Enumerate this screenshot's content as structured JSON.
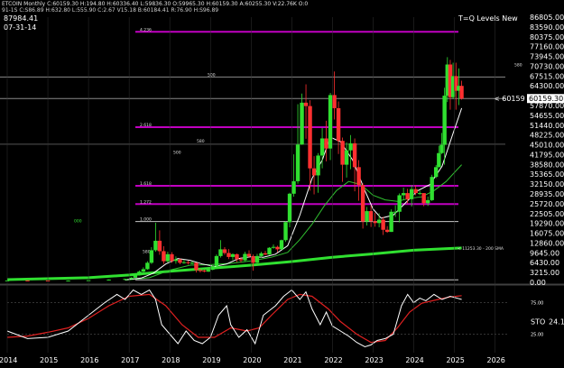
{
  "header": {
    "line1": "ETCOIN Monthly  C:60159.30  H:194.80  H:60336.40  L:59836.30  O:59965.30  H:60159.30  A:60255.30  V:22.76K  O:0",
    "line2": "91-1S  C:S86.89  H:632.80  L:555.90  C:2.67  V15.18  B:60184.41  R:76.90  H:S96.89",
    "price_box": "87984.41",
    "date_box": "07-31-14",
    "study_title": "T=Q Levels New"
  },
  "price_axis": [
    "86805.00",
    "83590.00",
    "80375.00",
    "77160.00",
    "73945.00",
    "70730.00",
    "67515.00",
    "64300.00",
    "60159.30",
    "57870.00",
    "54655.00",
    "51440.00",
    "48225.00",
    "45010.00",
    "41795.00",
    "38580.00",
    "35365.00",
    "32150.00",
    "28935.00",
    "25720.00",
    "22505.00",
    "19290.00",
    "16075.00",
    "12860.00",
    "9645.00",
    "6430.00",
    "3215.00",
    "0.00"
  ],
  "current_price_label": "< 60159",
  "level_labels": {
    "l4236": "4.236",
    "l500a": "500",
    "l2618": "2.618",
    "l580": "580",
    "l500b": "500",
    "l1618": "1.618",
    "l1272": "1.272",
    "l1000": "1.000",
    "l000": "000",
    "l580b": "580",
    "l580c": "580"
  },
  "sma_label": "< 11253.30 - 200 SMA",
  "stoch_axis": {
    "upper": "75.00",
    "lower": "25.00"
  },
  "stoch_label": "STO",
  "stoch_value": "24.1",
  "x_years": [
    "2014",
    "2015",
    "2016",
    "2017",
    "2018",
    "2019",
    "2020",
    "2021",
    "2022",
    "2023",
    "2024",
    "2025",
    "2026"
  ],
  "chart_data": {
    "type": "candlestick",
    "title": "T=Q Levels New",
    "ylim": [
      0,
      86805
    ],
    "x_range": [
      2014.0,
      2026.3
    ],
    "candles": [
      [
        2014.0,
        600,
        620,
        640,
        580
      ],
      [
        2014.5,
        620,
        600,
        650,
        580
      ],
      [
        2015.0,
        600,
        560,
        640,
        540
      ],
      [
        2015.5,
        560,
        600,
        620,
        540
      ],
      [
        2016.0,
        600,
        700,
        720,
        590
      ],
      [
        2016.5,
        700,
        900,
        950,
        680
      ],
      [
        2016.9,
        900,
        1100,
        1200,
        880
      ],
      [
        2017.05,
        1100,
        1500,
        1700,
        1050
      ],
      [
        2017.15,
        1500,
        2300,
        2600,
        1450
      ],
      [
        2017.25,
        2300,
        3500,
        3900,
        2200
      ],
      [
        2017.35,
        3500,
        4300,
        4900,
        3200
      ],
      [
        2017.45,
        4300,
        6400,
        6900,
        4100
      ],
      [
        2017.55,
        6400,
        10500,
        11500,
        6000
      ],
      [
        2017.65,
        10500,
        13600,
        19500,
        10000
      ],
      [
        2017.75,
        13600,
        10200,
        17000,
        9000
      ],
      [
        2017.85,
        10200,
        6900,
        11800,
        6000
      ],
      [
        2017.95,
        6900,
        9200,
        10000,
        6500
      ],
      [
        2018.05,
        9200,
        7000,
        9900,
        6400
      ],
      [
        2018.15,
        7000,
        7500,
        8500,
        6100
      ],
      [
        2018.25,
        7500,
        6400,
        7800,
        5900
      ],
      [
        2018.35,
        6400,
        6600,
        7400,
        6100
      ],
      [
        2018.45,
        6600,
        6300,
        7100,
        5800
      ],
      [
        2018.55,
        6300,
        6400,
        6900,
        5900
      ],
      [
        2018.65,
        6400,
        4000,
        6500,
        3200
      ],
      [
        2018.75,
        4000,
        3800,
        4400,
        3200
      ],
      [
        2018.85,
        3800,
        3500,
        4200,
        3300
      ],
      [
        2018.95,
        3500,
        4100,
        4200,
        3400
      ],
      [
        2019.05,
        4100,
        5300,
        5500,
        4000
      ],
      [
        2019.15,
        5300,
        8600,
        9100,
        5200
      ],
      [
        2019.25,
        8600,
        10800,
        13800,
        8100
      ],
      [
        2019.35,
        10800,
        9600,
        11500,
        9000
      ],
      [
        2019.45,
        9600,
        8300,
        10900,
        7600
      ],
      [
        2019.55,
        8300,
        9200,
        9500,
        7300
      ],
      [
        2019.65,
        9200,
        7600,
        9400,
        6600
      ],
      [
        2019.75,
        7600,
        7200,
        8300,
        6500
      ],
      [
        2019.85,
        7200,
        9300,
        10000,
        6900
      ],
      [
        2019.95,
        9300,
        8500,
        10500,
        8000
      ],
      [
        2020.05,
        8500,
        6400,
        9100,
        3800
      ],
      [
        2020.15,
        6400,
        8600,
        9300,
        6200
      ],
      [
        2020.25,
        8600,
        9500,
        10000,
        8100
      ],
      [
        2020.35,
        9500,
        9100,
        10300,
        8900
      ],
      [
        2020.45,
        9100,
        11300,
        11500,
        9000
      ],
      [
        2020.55,
        11300,
        11600,
        12400,
        11000
      ],
      [
        2020.65,
        11600,
        10800,
        12000,
        9900
      ],
      [
        2020.75,
        10800,
        13800,
        14000,
        10600
      ],
      [
        2020.85,
        13800,
        19700,
        19900,
        13200
      ],
      [
        2020.95,
        19700,
        29000,
        29300,
        18000
      ],
      [
        2021.05,
        29000,
        33100,
        41900,
        28000
      ],
      [
        2021.15,
        33100,
        45100,
        58300,
        32300
      ],
      [
        2021.25,
        45100,
        58800,
        61800,
        45000
      ],
      [
        2021.35,
        58800,
        57700,
        64800,
        47000
      ],
      [
        2021.45,
        57700,
        37300,
        59600,
        30000
      ],
      [
        2021.55,
        37300,
        35000,
        41300,
        28800
      ],
      [
        2021.65,
        35000,
        41500,
        42300,
        29300
      ],
      [
        2021.75,
        41500,
        47100,
        50500,
        37300
      ],
      [
        2021.85,
        47100,
        43800,
        52900,
        39600
      ],
      [
        2021.95,
        43800,
        61300,
        62000,
        40000
      ],
      [
        2022.05,
        61300,
        57000,
        69000,
        53300
      ],
      [
        2022.15,
        57000,
        46300,
        59200,
        42000
      ],
      [
        2022.25,
        46300,
        38500,
        47400,
        32900
      ],
      [
        2022.35,
        38500,
        43200,
        45800,
        34300
      ],
      [
        2022.45,
        43200,
        45500,
        48200,
        37000
      ],
      [
        2022.55,
        45500,
        37700,
        47100,
        29800
      ],
      [
        2022.65,
        37700,
        31800,
        40000,
        26700
      ],
      [
        2022.75,
        31800,
        19900,
        32400,
        17600
      ],
      [
        2022.85,
        19900,
        23300,
        24700,
        18600
      ],
      [
        2022.95,
        23300,
        20000,
        25200,
        18100
      ],
      [
        2023.05,
        20000,
        19400,
        22800,
        18200
      ],
      [
        2023.15,
        19400,
        20500,
        22600,
        18000
      ],
      [
        2023.25,
        20500,
        17200,
        21400,
        15500
      ],
      [
        2023.35,
        17200,
        16500,
        18400,
        16200
      ],
      [
        2023.45,
        16500,
        23100,
        23900,
        16500
      ],
      [
        2023.55,
        23100,
        23100,
        25200,
        21400
      ],
      [
        2023.65,
        23100,
        28500,
        29100,
        19600
      ],
      [
        2023.75,
        28500,
        29200,
        31000,
        26900
      ],
      [
        2023.85,
        29200,
        27200,
        30600,
        25800
      ],
      [
        2023.95,
        27200,
        30500,
        31800,
        24800
      ],
      [
        2024.05,
        30500,
        29200,
        31800,
        28500
      ],
      [
        2024.15,
        29200,
        29200,
        30000,
        28500
      ],
      [
        2024.25,
        29200,
        25900,
        29200,
        24900
      ],
      [
        2024.35,
        25900,
        26900,
        28100,
        25000
      ],
      [
        2024.45,
        26900,
        34500,
        35200,
        26600
      ],
      [
        2024.55,
        34500,
        37700,
        38400,
        34100
      ],
      [
        2024.62,
        37700,
        42300,
        44700,
        37600
      ],
      [
        2024.69,
        42300,
        45000,
        48900,
        42000
      ],
      [
        2024.76,
        45000,
        61100,
        63700,
        38500
      ],
      [
        2024.83,
        61100,
        71300,
        73700,
        59000
      ],
      [
        2024.9,
        71300,
        60600,
        72800,
        56500
      ],
      [
        2024.97,
        60600,
        67500,
        71900,
        60000
      ],
      [
        2025.04,
        67500,
        62700,
        71900,
        56500
      ],
      [
        2025.11,
        62700,
        64300,
        70000,
        58000
      ],
      [
        2025.18,
        64300,
        60159,
        66000,
        59800
      ]
    ],
    "sma_fast": [
      [
        2016.9,
        800
      ],
      [
        2017.3,
        1400
      ],
      [
        2017.6,
        3000
      ],
      [
        2017.9,
        6000
      ],
      [
        2018.2,
        7800
      ],
      [
        2018.5,
        7200
      ],
      [
        2018.8,
        6000
      ],
      [
        2019.1,
        5200
      ],
      [
        2019.4,
        6000
      ],
      [
        2019.7,
        7800
      ],
      [
        2020.0,
        8400
      ],
      [
        2020.3,
        8200
      ],
      [
        2020.6,
        9200
      ],
      [
        2020.9,
        12000
      ],
      [
        2021.2,
        22000
      ],
      [
        2021.5,
        34000
      ],
      [
        2021.75,
        40000
      ],
      [
        2021.95,
        47500
      ],
      [
        2022.2,
        46000
      ],
      [
        2022.5,
        40000
      ],
      [
        2022.8,
        30000
      ],
      [
        2023.0,
        24000
      ],
      [
        2023.2,
        21000
      ],
      [
        2023.5,
        22000
      ],
      [
        2023.8,
        26000
      ],
      [
        2024.1,
        30000
      ],
      [
        2024.4,
        32000
      ],
      [
        2024.7,
        38000
      ],
      [
        2024.95,
        48000
      ],
      [
        2025.18,
        57000
      ]
    ],
    "sma_mid": [
      [
        2016.9,
        700
      ],
      [
        2017.5,
        1500
      ],
      [
        2018.0,
        4000
      ],
      [
        2018.5,
        5600
      ],
      [
        2019.0,
        5800
      ],
      [
        2019.5,
        6200
      ],
      [
        2020.0,
        7000
      ],
      [
        2020.5,
        8200
      ],
      [
        2020.9,
        9800
      ],
      [
        2021.2,
        14000
      ],
      [
        2021.5,
        19000
      ],
      [
        2021.8,
        25000
      ],
      [
        2022.1,
        30000
      ],
      [
        2022.4,
        33000
      ],
      [
        2022.7,
        32000
      ],
      [
        2023.0,
        28500
      ],
      [
        2023.3,
        27000
      ],
      [
        2023.6,
        26500
      ],
      [
        2023.9,
        27500
      ],
      [
        2024.2,
        28000
      ],
      [
        2024.5,
        30000
      ],
      [
        2024.8,
        33000
      ],
      [
        2025.18,
        38500
      ]
    ],
    "sma_200": [
      [
        2014.0,
        900
      ],
      [
        2016.0,
        1500
      ],
      [
        2017.0,
        2400
      ],
      [
        2018.0,
        3600
      ],
      [
        2019.0,
        4600
      ],
      [
        2020.0,
        5600
      ],
      [
        2021.0,
        6800
      ],
      [
        2022.0,
        8200
      ],
      [
        2023.0,
        9300
      ],
      [
        2024.0,
        10500
      ],
      [
        2025.18,
        11253
      ]
    ],
    "horizontal_levels": [
      {
        "value": 82000,
        "color": "#c000c0"
      },
      {
        "value": 50800,
        "color": "#c000c0"
      },
      {
        "value": 31600,
        "color": "#c000c0"
      },
      {
        "value": 25600,
        "color": "#c000c0"
      },
      {
        "value": 19900,
        "color": "#c8c8c8"
      },
      {
        "value": 67200,
        "color": "#888888"
      },
      {
        "value": 60159,
        "color": "#888888"
      },
      {
        "value": 45200,
        "color": "#555555"
      },
      {
        "value": 800,
        "color": "#c8c8c8"
      }
    ],
    "stochastic": {
      "levels": [
        75,
        25
      ],
      "k": [
        [
          2014.0,
          30
        ],
        [
          2014.5,
          18
        ],
        [
          2015.0,
          20
        ],
        [
          2015.5,
          30
        ],
        [
          2016.0,
          55
        ],
        [
          2016.4,
          75
        ],
        [
          2016.7,
          88
        ],
        [
          2016.9,
          80
        ],
        [
          2017.1,
          95
        ],
        [
          2017.3,
          88
        ],
        [
          2017.5,
          95
        ],
        [
          2017.65,
          80
        ],
        [
          2017.8,
          40
        ],
        [
          2018.0,
          25
        ],
        [
          2018.2,
          10
        ],
        [
          2018.4,
          30
        ],
        [
          2018.6,
          15
        ],
        [
          2018.8,
          10
        ],
        [
          2019.0,
          20
        ],
        [
          2019.2,
          55
        ],
        [
          2019.4,
          70
        ],
        [
          2019.5,
          40
        ],
        [
          2019.7,
          20
        ],
        [
          2019.9,
          32
        ],
        [
          2020.1,
          10
        ],
        [
          2020.3,
          55
        ],
        [
          2020.6,
          70
        ],
        [
          2020.8,
          85
        ],
        [
          2021.0,
          95
        ],
        [
          2021.2,
          80
        ],
        [
          2021.35,
          92
        ],
        [
          2021.5,
          65
        ],
        [
          2021.7,
          40
        ],
        [
          2021.85,
          60
        ],
        [
          2022.0,
          38
        ],
        [
          2022.2,
          30
        ],
        [
          2022.4,
          22
        ],
        [
          2022.6,
          12
        ],
        [
          2022.8,
          5
        ],
        [
          2022.95,
          8
        ],
        [
          2023.1,
          15
        ],
        [
          2023.3,
          18
        ],
        [
          2023.5,
          25
        ],
        [
          2023.7,
          70
        ],
        [
          2023.85,
          88
        ],
        [
          2024.0,
          75
        ],
        [
          2024.15,
          82
        ],
        [
          2024.3,
          78
        ],
        [
          2024.5,
          88
        ],
        [
          2024.7,
          80
        ],
        [
          2024.9,
          85
        ],
        [
          2025.18,
          80
        ]
      ],
      "d": [
        [
          2014.0,
          20
        ],
        [
          2014.5,
          22
        ],
        [
          2015.0,
          28
        ],
        [
          2015.5,
          35
        ],
        [
          2016.0,
          50
        ],
        [
          2016.5,
          70
        ],
        [
          2017.0,
          85
        ],
        [
          2017.5,
          88
        ],
        [
          2017.9,
          70
        ],
        [
          2018.3,
          40
        ],
        [
          2018.7,
          20
        ],
        [
          2019.1,
          20
        ],
        [
          2019.5,
          35
        ],
        [
          2019.9,
          30
        ],
        [
          2020.2,
          35
        ],
        [
          2020.5,
          55
        ],
        [
          2020.9,
          80
        ],
        [
          2021.2,
          88
        ],
        [
          2021.5,
          85
        ],
        [
          2021.9,
          65
        ],
        [
          2022.2,
          45
        ],
        [
          2022.6,
          25
        ],
        [
          2022.95,
          12
        ],
        [
          2023.3,
          15
        ],
        [
          2023.6,
          35
        ],
        [
          2023.9,
          60
        ],
        [
          2024.2,
          74
        ],
        [
          2024.6,
          80
        ],
        [
          2024.9,
          84
        ],
        [
          2025.18,
          86
        ]
      ],
      "ylim": [
        0,
        100
      ]
    }
  }
}
